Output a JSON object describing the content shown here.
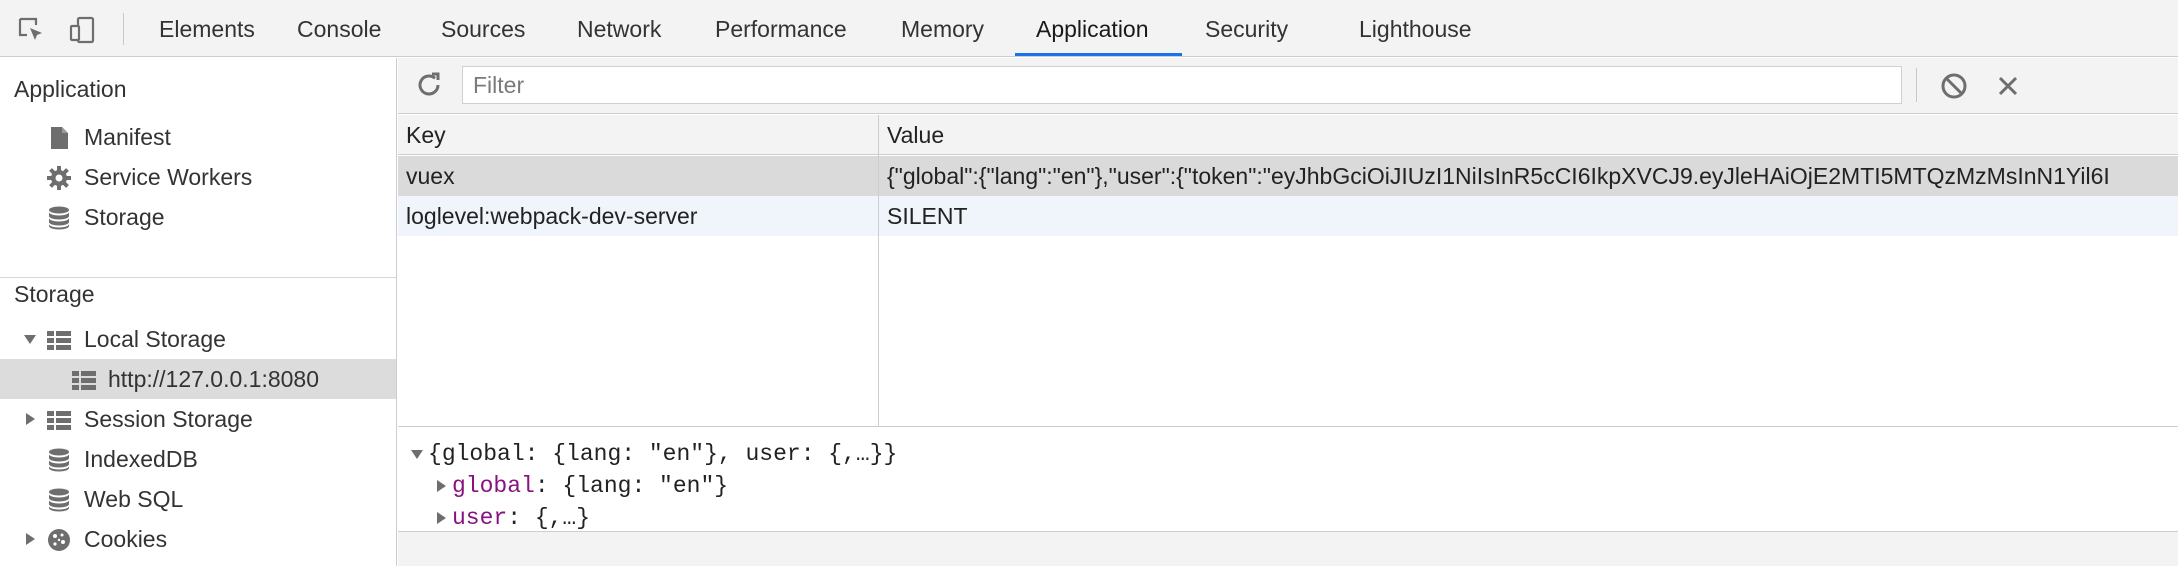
{
  "tabs": [
    {
      "label": "Elements"
    },
    {
      "label": "Console"
    },
    {
      "label": "Sources"
    },
    {
      "label": "Network"
    },
    {
      "label": "Performance"
    },
    {
      "label": "Memory"
    },
    {
      "label": "Application",
      "active": true
    },
    {
      "label": "Security"
    },
    {
      "label": "Lighthouse"
    }
  ],
  "sidebar": {
    "application_heading": "Application",
    "application_items": [
      {
        "label": "Manifest",
        "icon": "file-icon"
      },
      {
        "label": "Service Workers",
        "icon": "gear-icon"
      },
      {
        "label": "Storage",
        "icon": "database-icon"
      }
    ],
    "storage_heading": "Storage",
    "storage_items": [
      {
        "label": "Local Storage",
        "icon": "grid-icon",
        "expanded": true
      },
      {
        "label": "http://127.0.0.1:8080",
        "icon": "grid-icon",
        "selected": true
      },
      {
        "label": "Session Storage",
        "icon": "grid-icon",
        "expanded": false
      },
      {
        "label": "IndexedDB",
        "icon": "database-icon"
      },
      {
        "label": "Web SQL",
        "icon": "database-icon"
      },
      {
        "label": "Cookies",
        "icon": "cookie-icon",
        "expanded": false
      }
    ]
  },
  "toolbar": {
    "filter_placeholder": "Filter"
  },
  "table": {
    "headers": {
      "key": "Key",
      "value": "Value"
    },
    "rows": [
      {
        "key": "vuex",
        "value": "{\"global\":{\"lang\":\"en\"},\"user\":{\"token\":\"eyJhbGciOiJIUzI1NiIsInR5cCI6IkpXVCJ9.eyJleHAiOjE2MTI5MTQzMzMsInN1Yil6I"
      },
      {
        "key": "loglevel:webpack-dev-server",
        "value": "SILENT"
      }
    ]
  },
  "preview": {
    "root_prefix": "{",
    "root_global_key": "global",
    "root_global_val": ": {lang: \"en\"}, ",
    "root_user_key": "user",
    "root_user_val": ": {,…}}",
    "line_global_key": "global",
    "line_global_val": ": {lang: \"en\"}",
    "line_user_key": "user",
    "line_user_val": ": {,…}"
  },
  "colors": {
    "accent": "#1a73e8",
    "property": "#881280",
    "selected_row": "#dadada"
  }
}
